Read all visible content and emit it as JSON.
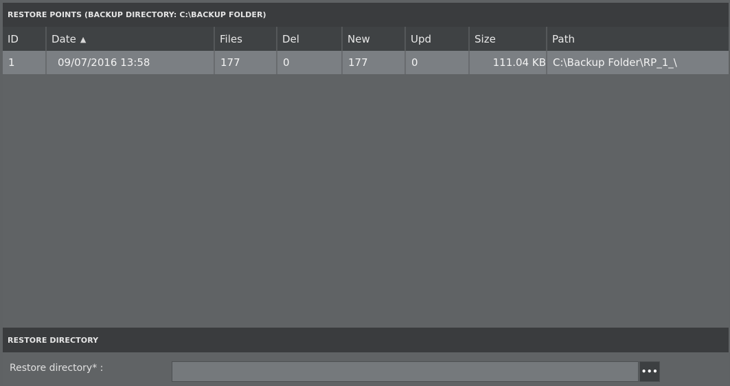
{
  "restore_points": {
    "header": "RESTORE POINTS (BACKUP DIRECTORY: C:\\BACKUP FOLDER)",
    "columns": [
      "ID",
      "Date",
      "Files",
      "Del",
      "New",
      "Upd",
      "Size",
      "Path"
    ],
    "sort_icon": "sort-ascending-icon",
    "rows": [
      {
        "id": "1",
        "date": "09/07/2016 13:58",
        "files": "177",
        "del": "0",
        "new": "177",
        "upd": "0",
        "size": "111.04 KB",
        "path": "C:\\Backup Folder\\RP_1_\\"
      }
    ]
  },
  "restore_directory": {
    "header": "RESTORE DIRECTORY",
    "label": "Restore directory* :",
    "value": "",
    "browse_label": "•••"
  },
  "colors": {
    "panel_bg": "#606365",
    "header_bg": "#3a3c3e",
    "column_header_bg": "#3f4244",
    "row_bg": "#7b7f83"
  }
}
